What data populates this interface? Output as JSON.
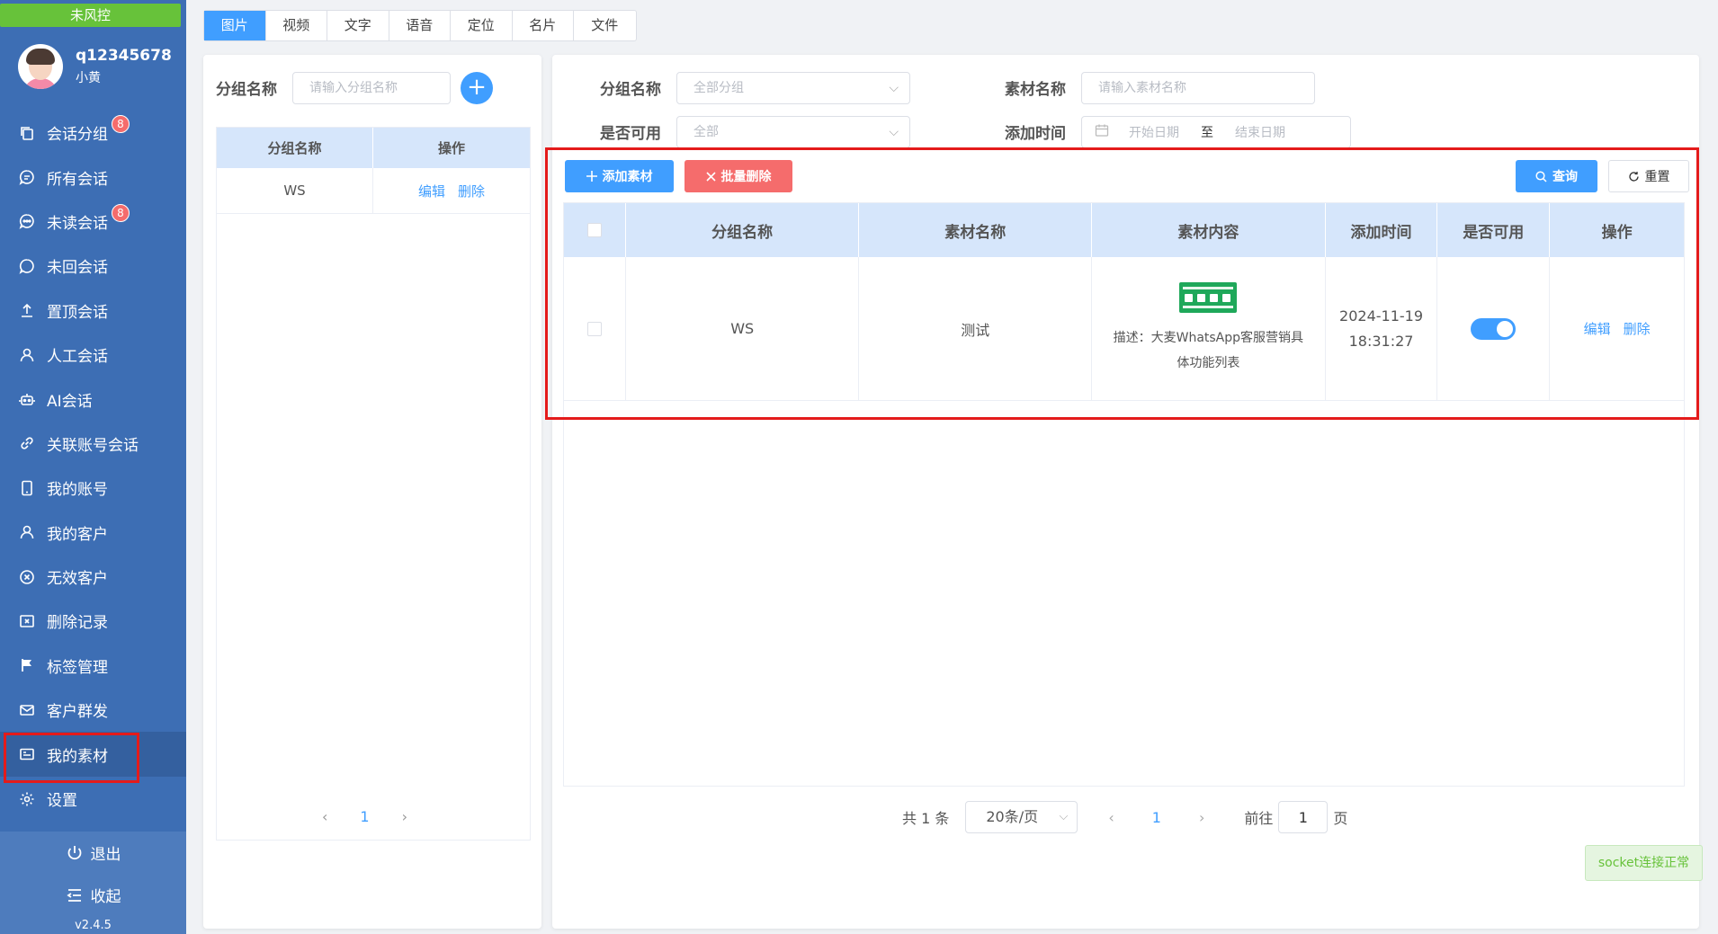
{
  "sidebar": {
    "risk_status": "未风控",
    "username": "q12345678",
    "nickname": "小黄",
    "nav": [
      {
        "label": "会话分组",
        "icon": "copy-icon",
        "badge": "8"
      },
      {
        "label": "所有会话",
        "icon": "chat-icon",
        "badge": ""
      },
      {
        "label": "未读会话",
        "icon": "chat-dots-icon",
        "badge": "8"
      },
      {
        "label": "未回会话",
        "icon": "chat-bubble-icon",
        "badge": ""
      },
      {
        "label": "置顶会话",
        "icon": "pin-top-icon",
        "badge": ""
      },
      {
        "label": "人工会话",
        "icon": "user-icon",
        "badge": ""
      },
      {
        "label": "AI会话",
        "icon": "robot-icon",
        "badge": ""
      },
      {
        "label": "关联账号会话",
        "icon": "link-icon",
        "badge": ""
      },
      {
        "label": "我的账号",
        "icon": "phone-icon",
        "badge": ""
      },
      {
        "label": "我的客户",
        "icon": "user-icon",
        "badge": ""
      },
      {
        "label": "无效客户",
        "icon": "circle-x-icon",
        "badge": ""
      },
      {
        "label": "删除记录",
        "icon": "box-x-icon",
        "badge": ""
      },
      {
        "label": "标签管理",
        "icon": "flag-icon",
        "badge": ""
      },
      {
        "label": "客户群发",
        "icon": "mail-icon",
        "badge": ""
      },
      {
        "label": "我的素材",
        "icon": "material-icon",
        "badge": "",
        "active": true
      },
      {
        "label": "设置",
        "icon": "gear-icon",
        "badge": ""
      }
    ],
    "logout_label": "退出",
    "collapse_label": "收起",
    "version": "v2.4.5"
  },
  "type_tabs": [
    "图片",
    "视频",
    "文字",
    "语音",
    "定位",
    "名片",
    "文件"
  ],
  "group_panel": {
    "filter_label": "分组名称",
    "filter_placeholder": "请输入分组名称",
    "add_symbol": "+",
    "headers": [
      "分组名称",
      "操作"
    ],
    "rows": [
      {
        "name": "WS",
        "edit": "编辑",
        "delete": "删除"
      }
    ],
    "page": "1"
  },
  "filters": {
    "group_label": "分组名称",
    "group_value": "全部分组",
    "name_label": "素材名称",
    "name_placeholder": "请输入素材名称",
    "available_label": "是否可用",
    "available_value": "全部",
    "time_label": "添加时间",
    "start_placeholder": "开始日期",
    "to": "至",
    "end_placeholder": "结束日期"
  },
  "actions": {
    "add": "添加素材",
    "batch_delete": "批量删除",
    "query": "查询",
    "reset": "重置"
  },
  "table": {
    "headers": [
      "分组名称",
      "素材名称",
      "素材内容",
      "添加时间",
      "是否可用",
      "操作"
    ],
    "rows": [
      {
        "group": "WS",
        "name": "测试",
        "desc_line1": "描述：大麦WhatsApp客服营销具",
        "desc_line2": "体功能列表",
        "date": "2024-11-19",
        "time": "18:31:27",
        "enabled": true,
        "edit": "编辑",
        "delete": "删除"
      }
    ]
  },
  "pagination": {
    "total": "共 1 条",
    "size": "20条/页",
    "page": "1",
    "goto_prefix": "前往",
    "goto_value": "1",
    "goto_suffix": "页"
  },
  "socket_status": "socket连接正常",
  "colors": {
    "sidebar": "#3d6eb4",
    "primary": "#409eff",
    "danger": "#f56c6c",
    "success": "#67c23a"
  }
}
